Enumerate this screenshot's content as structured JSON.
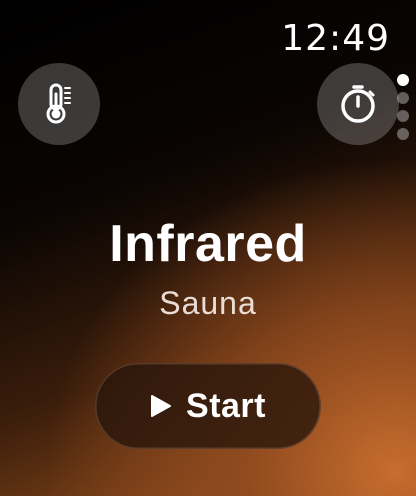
{
  "status_bar": {
    "time": "12:49"
  },
  "controls": {
    "left_icon": "thermometer-icon",
    "right_icon": "stopwatch-icon"
  },
  "pagination": {
    "count": 4,
    "active_index": 0
  },
  "workout": {
    "title": "Infrared",
    "subtitle": "Sauna"
  },
  "start_button": {
    "label": "Start",
    "icon": "play-icon"
  },
  "colors": {
    "background_dark": "#000000",
    "background_warm": "#c76d2e",
    "text": "#ffffff",
    "subtitle_text": "#e9ddd5"
  }
}
